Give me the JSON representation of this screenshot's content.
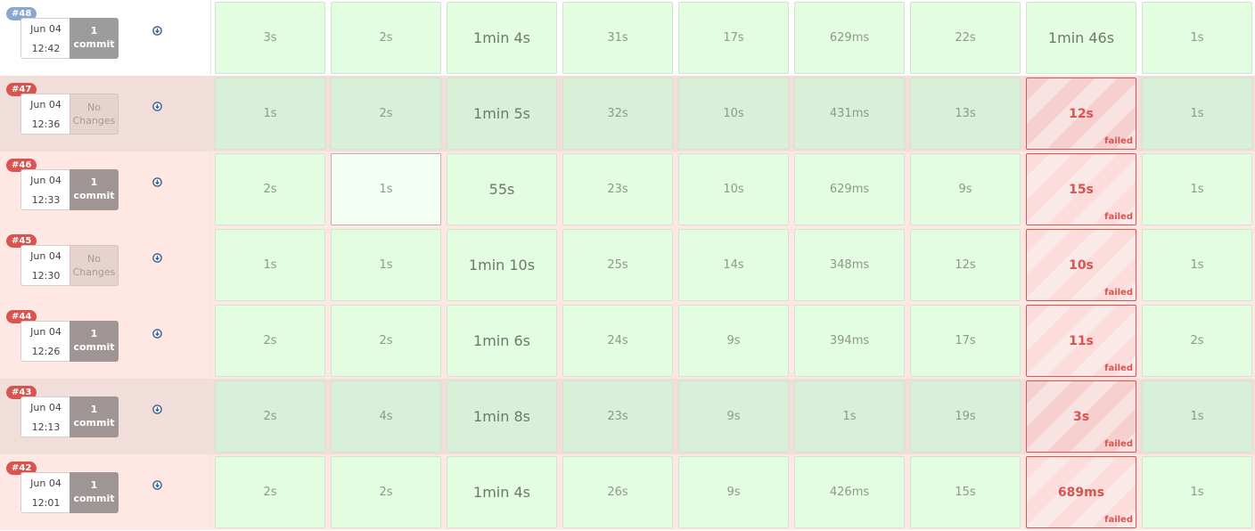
{
  "builds": [
    {
      "number": "#48",
      "status": "success",
      "date": "Jun 04",
      "time": "12:42",
      "changes": {
        "type": "commit",
        "line1": "1",
        "line2": "commit"
      },
      "stages": [
        {
          "duration": "3s"
        },
        {
          "duration": "2s"
        },
        {
          "duration": "1min 4s"
        },
        {
          "duration": "31s"
        },
        {
          "duration": "17s"
        },
        {
          "duration": "629ms"
        },
        {
          "duration": "22s"
        },
        {
          "duration": "1min 46s"
        },
        {
          "duration": "1s"
        }
      ]
    },
    {
      "number": "#47",
      "status": "failed",
      "highlighted": true,
      "date": "Jun 04",
      "time": "12:36",
      "changes": {
        "type": "none",
        "line1": "No",
        "line2": "Changes"
      },
      "stages": [
        {
          "duration": "1s"
        },
        {
          "duration": "2s"
        },
        {
          "duration": "1min 5s"
        },
        {
          "duration": "32s"
        },
        {
          "duration": "10s"
        },
        {
          "duration": "431ms"
        },
        {
          "duration": "13s"
        },
        {
          "duration": "12s",
          "failed": true,
          "label": "failed"
        },
        {
          "duration": "1s"
        }
      ]
    },
    {
      "number": "#46",
      "status": "failed",
      "date": "Jun 04",
      "time": "12:33",
      "changes": {
        "type": "commit",
        "line1": "1",
        "line2": "commit"
      },
      "stages": [
        {
          "duration": "2s"
        },
        {
          "duration": "1s",
          "selected": true
        },
        {
          "duration": "55s"
        },
        {
          "duration": "23s"
        },
        {
          "duration": "10s"
        },
        {
          "duration": "629ms"
        },
        {
          "duration": "9s"
        },
        {
          "duration": "15s",
          "failed": true,
          "label": "failed"
        },
        {
          "duration": "1s"
        }
      ]
    },
    {
      "number": "#45",
      "status": "failed",
      "date": "Jun 04",
      "time": "12:30",
      "changes": {
        "type": "none",
        "line1": "No",
        "line2": "Changes"
      },
      "stages": [
        {
          "duration": "1s"
        },
        {
          "duration": "1s"
        },
        {
          "duration": "1min 10s"
        },
        {
          "duration": "25s"
        },
        {
          "duration": "14s"
        },
        {
          "duration": "348ms"
        },
        {
          "duration": "12s"
        },
        {
          "duration": "10s",
          "failed": true,
          "label": "failed"
        },
        {
          "duration": "1s"
        }
      ]
    },
    {
      "number": "#44",
      "status": "failed",
      "date": "Jun 04",
      "time": "12:26",
      "changes": {
        "type": "commit",
        "line1": "1",
        "line2": "commit"
      },
      "stages": [
        {
          "duration": "2s"
        },
        {
          "duration": "2s"
        },
        {
          "duration": "1min 6s"
        },
        {
          "duration": "24s"
        },
        {
          "duration": "9s"
        },
        {
          "duration": "394ms"
        },
        {
          "duration": "17s"
        },
        {
          "duration": "11s",
          "failed": true,
          "label": "failed"
        },
        {
          "duration": "2s"
        }
      ]
    },
    {
      "number": "#43",
      "status": "failed",
      "highlighted": true,
      "date": "Jun 04",
      "time": "12:13",
      "changes": {
        "type": "commit",
        "line1": "1",
        "line2": "commit"
      },
      "stages": [
        {
          "duration": "2s"
        },
        {
          "duration": "4s"
        },
        {
          "duration": "1min 8s"
        },
        {
          "duration": "23s"
        },
        {
          "duration": "9s"
        },
        {
          "duration": "1s"
        },
        {
          "duration": "19s"
        },
        {
          "duration": "3s",
          "failed": true,
          "label": "failed"
        },
        {
          "duration": "1s"
        }
      ]
    },
    {
      "number": "#42",
      "status": "failed",
      "date": "Jun 04",
      "time": "12:01",
      "changes": {
        "type": "commit",
        "line1": "1",
        "line2": "commit"
      },
      "stages": [
        {
          "duration": "2s"
        },
        {
          "duration": "2s"
        },
        {
          "duration": "1min 4s"
        },
        {
          "duration": "26s"
        },
        {
          "duration": "9s"
        },
        {
          "duration": "426ms"
        },
        {
          "duration": "15s"
        },
        {
          "duration": "689ms",
          "failed": true,
          "label": "failed"
        },
        {
          "duration": "1s"
        }
      ]
    }
  ],
  "colors": {
    "success_cell": "#e3fde1",
    "failed": "#d9534f",
    "failed_row": "#ffe7e4",
    "badge_success": "#8aa8cf"
  },
  "icons": {
    "details": "arrow-circle-down-icon"
  }
}
